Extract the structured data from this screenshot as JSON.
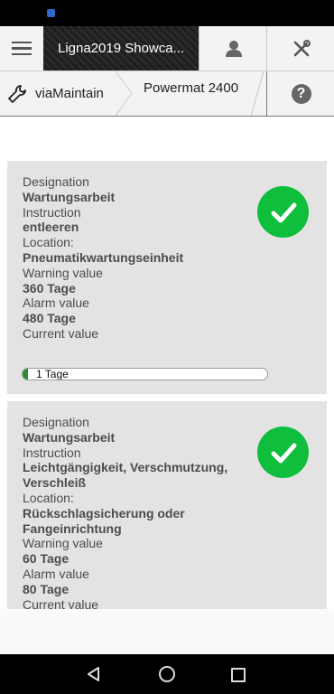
{
  "app": {
    "title": "Ligna2019 Showca...",
    "menu_icon": "hamburger-icon",
    "user_icon": "user-icon",
    "tools_icon": "tools-icon"
  },
  "breadcrumb": {
    "section": "viaMaintain",
    "section_icon": "wrench-icon",
    "machine": "Powermat 2400",
    "help_icon": "help-icon"
  },
  "labels": {
    "designation": "Designation",
    "instruction": "Instruction",
    "location": "Location:",
    "warning": "Warning value",
    "alarm": "Alarm value",
    "current": "Current value"
  },
  "colors": {
    "status_ok": "#0fbe3c",
    "progress_fill": "#2e8b2e"
  },
  "items": [
    {
      "designation": "Wartungsarbeit",
      "instruction": "entleeren",
      "location": "Pneumatikwartungseinheit",
      "warning": "360 Tage",
      "alarm": "480 Tage",
      "current": "1 Tage",
      "progress": 0.02,
      "status_icon": "checkmark-icon"
    },
    {
      "designation": "Wartungsarbeit",
      "instruction": "Leichtgängigkeit, Verschmutzung, Verschleiß",
      "location": "Rückschlagsicherung oder Fangeinrichtung",
      "warning": "60 Tage",
      "alarm": "80 Tage",
      "status_icon": "checkmark-icon"
    }
  ]
}
